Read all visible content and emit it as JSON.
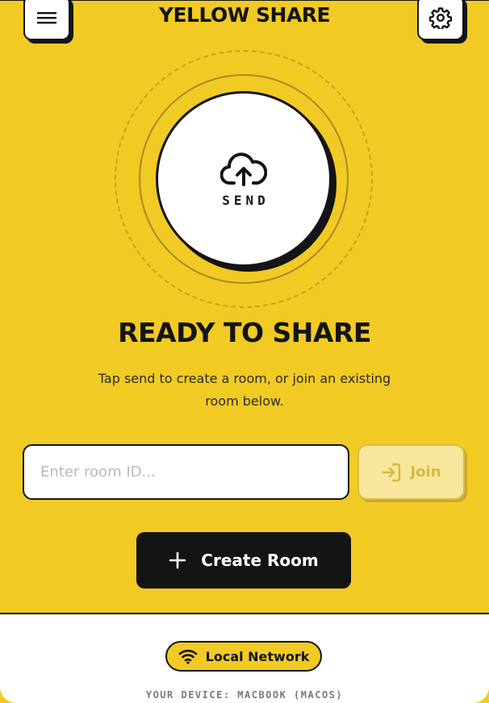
{
  "header": {
    "title": "YELLOW SHARE",
    "menu_icon": "menu-icon",
    "settings_icon": "gear-icon"
  },
  "send": {
    "label": "SEND",
    "icon": "cloud-upload-icon"
  },
  "status": {
    "title": "READY TO SHARE",
    "subtitle": "Tap send to create a room, or join an existing room below."
  },
  "join": {
    "input_placeholder": "Enter room ID...",
    "input_value": "",
    "button_label": "Join",
    "button_icon": "login-icon"
  },
  "create": {
    "button_label": "Create Room",
    "button_icon": "plus-icon"
  },
  "footer": {
    "network_label": "Local Network",
    "network_icon": "wifi-icon",
    "device_label": "YOUR DEVICE: MACBOOK (MACOS)"
  },
  "colors": {
    "background": "#F1CA24",
    "ink": "#141414",
    "surface": "#FFFFFF",
    "join_disabled": "#F8E69C"
  }
}
